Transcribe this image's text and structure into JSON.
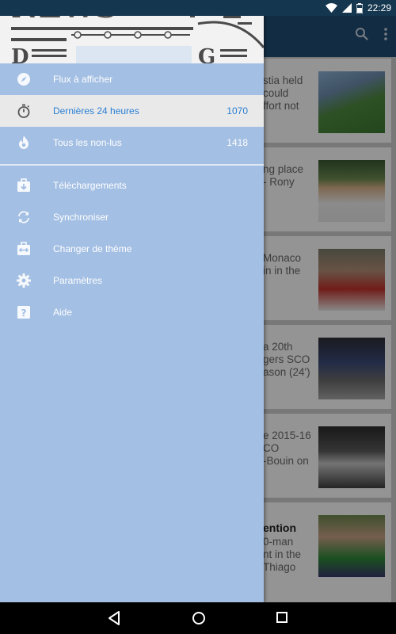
{
  "status_bar": {
    "time": "22:29"
  },
  "drawer": {
    "items": [
      {
        "label": "Flux à afficher",
        "count": "",
        "icon": "compass-icon"
      },
      {
        "label": "Dernières 24 heures",
        "count": "1070",
        "icon": "stopwatch-icon",
        "selected": true
      },
      {
        "label": "Tous les non-lus",
        "count": "1418",
        "icon": "flame-icon"
      }
    ],
    "secondary": [
      {
        "label": "Téléchargements",
        "icon": "download-briefcase-icon"
      },
      {
        "label": "Synchroniser",
        "icon": "sync-icon"
      },
      {
        "label": "Changer de thème",
        "icon": "swap-theme-icon"
      },
      {
        "label": "Paramètres",
        "icon": "gear-icon"
      },
      {
        "label": "Aide",
        "icon": "help-icon"
      }
    ]
  },
  "articles": [
    {
      "text": "stia held\ncould\nffort not",
      "bold": false
    },
    {
      "text": "ng place\n- Rony",
      "bold": false
    },
    {
      "text": "Monaco\nin in the",
      "bold": false
    },
    {
      "text": "a 20th\ngers SCO\nason (24')",
      "bold": false
    },
    {
      "text": "e 2015-16\nCO\n-Bouin on",
      "bold": false
    },
    {
      "text": "ention",
      "bold": true,
      "extra": "0-man\nnt in the\nThiago"
    }
  ],
  "colors": {
    "drawer_bg": "#a3bfe3",
    "selected_text": "#2a7fd4",
    "appbar": "#1f4e74",
    "statusbar": "#15364f"
  }
}
